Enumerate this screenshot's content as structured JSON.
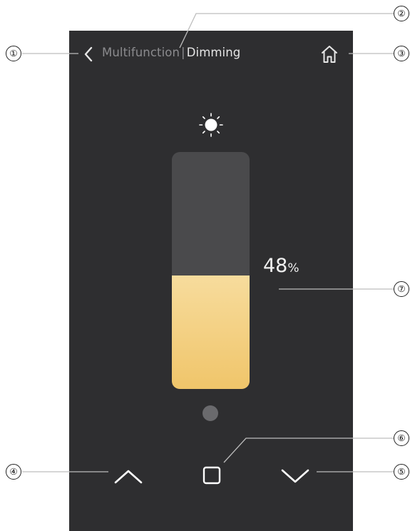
{
  "header": {
    "parent_label": "Multifunction",
    "separator": "|",
    "current_label": "Dimming"
  },
  "icons": {
    "back": "chevron-left-icon",
    "home": "home-icon",
    "brightness": "sun-icon",
    "up": "chevron-up-icon",
    "stop": "stop-square-icon",
    "down": "chevron-down-icon"
  },
  "dimmer": {
    "level_percent": 48,
    "value_text": "48",
    "unit_text": "%",
    "fill_color": "#f0c56a",
    "track_color": "#4a4a4c"
  },
  "callouts": [
    "①",
    "②",
    "③",
    "④",
    "⑤",
    "⑥",
    "⑦"
  ],
  "colors": {
    "screen_bg": "#2e2e30",
    "text_dim": "#8b8b8e",
    "text_bright": "#e6e6e6"
  }
}
